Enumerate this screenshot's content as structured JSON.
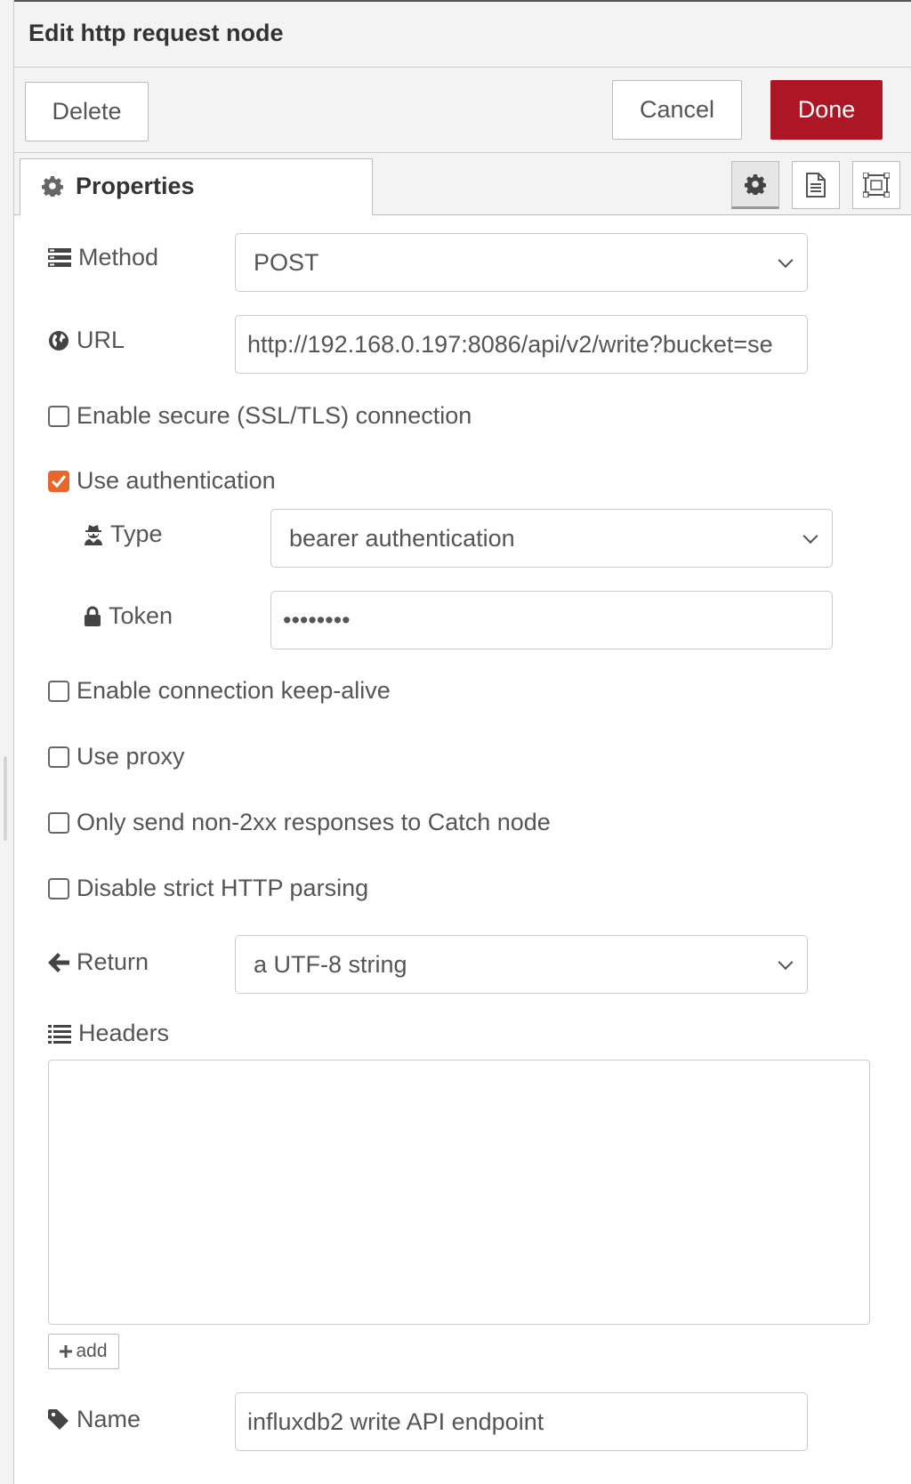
{
  "dialog": {
    "title": "Edit http request node",
    "delete_label": "Delete",
    "cancel_label": "Cancel",
    "done_label": "Done"
  },
  "tabs": {
    "properties_label": "Properties",
    "icons": [
      "gear-icon",
      "document-icon",
      "frame-icon"
    ]
  },
  "form": {
    "method": {
      "label": "Method",
      "value": "POST"
    },
    "url": {
      "label": "URL",
      "value": "http://192.168.0.197:8086/api/v2/write?bucket=se"
    },
    "ssl": {
      "label": "Enable secure (SSL/TLS) connection",
      "checked": false
    },
    "auth": {
      "label": "Use authentication",
      "checked": true
    },
    "auth_type": {
      "label": "Type",
      "value": "bearer authentication"
    },
    "token": {
      "label": "Token",
      "value": "••••••••"
    },
    "keepalive": {
      "label": "Enable connection keep-alive",
      "checked": false
    },
    "proxy": {
      "label": "Use proxy",
      "checked": false
    },
    "non2xx": {
      "label": "Only send non-2xx responses to Catch node",
      "checked": false
    },
    "strict_parsing": {
      "label": "Disable strict HTTP parsing",
      "checked": false
    },
    "return": {
      "label": "Return",
      "value": "a UTF-8 string"
    },
    "headers": {
      "label": "Headers",
      "add_label": "add"
    },
    "name": {
      "label": "Name",
      "value": "influxdb2 write API endpoint"
    }
  },
  "colors": {
    "done_button": "#ad1625",
    "checkbox_checked": "#e8662b"
  }
}
